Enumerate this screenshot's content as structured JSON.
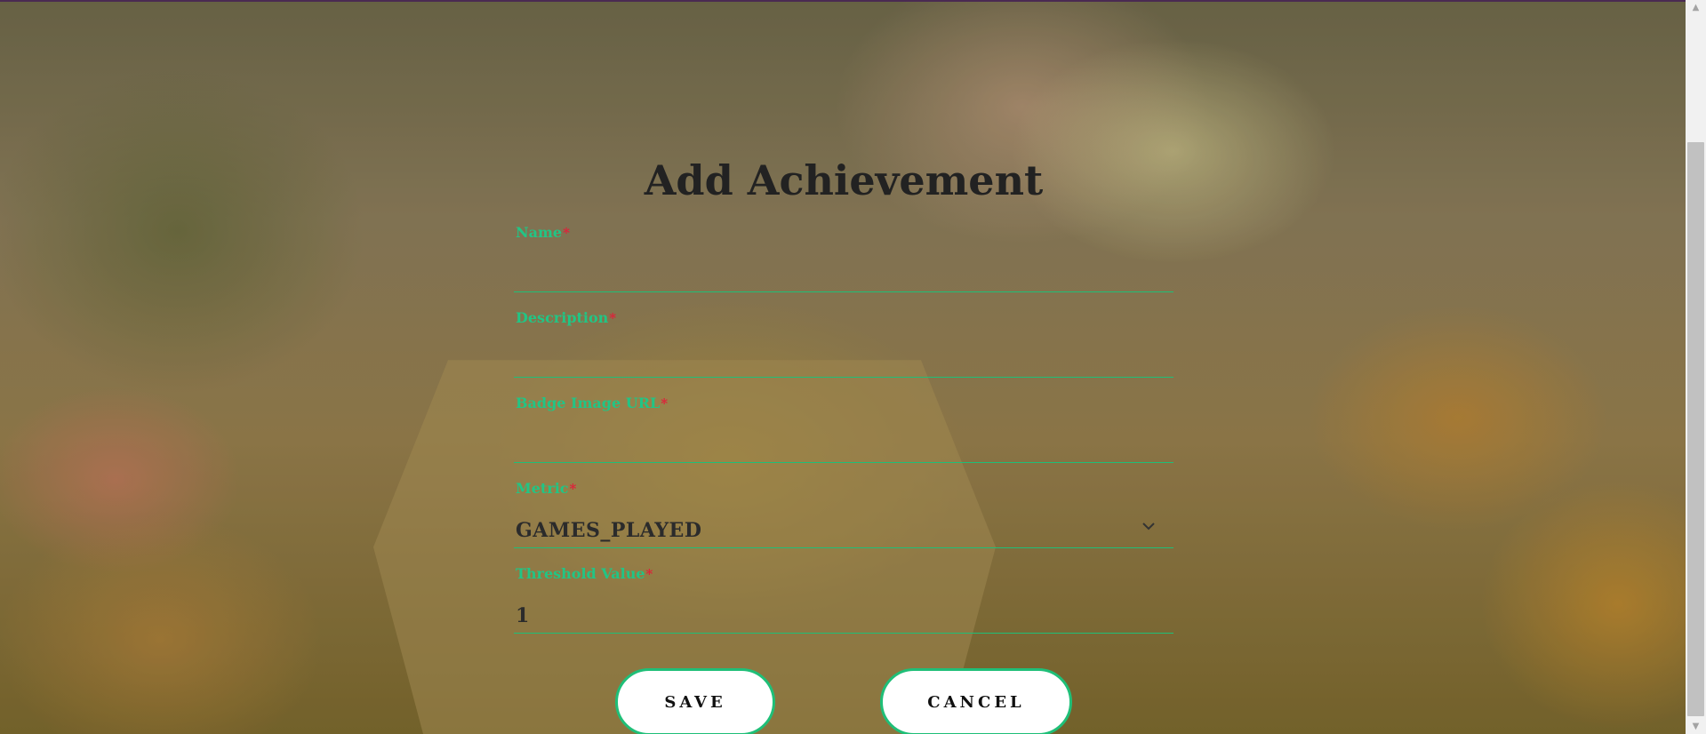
{
  "form": {
    "title": "Add Achievement",
    "fields": [
      {
        "label": "Name",
        "required_mark": "*",
        "value": ""
      },
      {
        "label": "Description",
        "required_mark": "*",
        "value": ""
      },
      {
        "label": "Badge Image URL",
        "required_mark": "*",
        "value": ""
      },
      {
        "label": "Metric",
        "required_mark": "*",
        "value": "GAMES_PLAYED"
      },
      {
        "label": "Threshold Value",
        "required_mark": "*",
        "value": "1"
      }
    ],
    "save_label": "SAVE",
    "cancel_label": "CANCEL"
  },
  "colors": {
    "accent": "#1fbf78",
    "label": "#21c585",
    "required": "#e0203a",
    "title": "#222222"
  },
  "icons": {
    "metric_dropdown": "chevron-down-icon",
    "scroll_up": "arrow-up-icon",
    "scroll_down": "arrow-down-icon"
  }
}
